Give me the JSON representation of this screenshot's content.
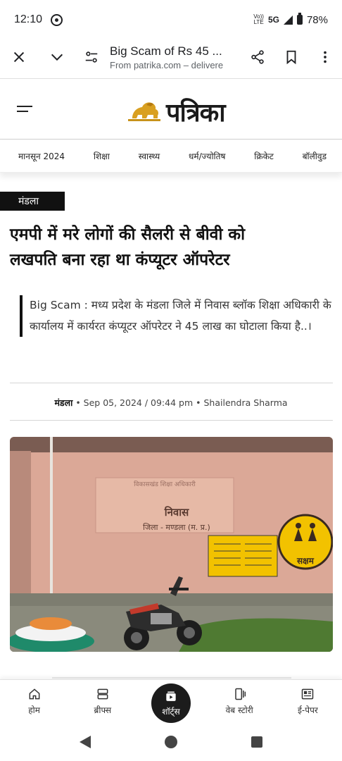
{
  "status_bar": {
    "time": "12:10",
    "network_top": "Vo)) ",
    "network_lte": "LTE",
    "network": "5G",
    "battery": "78%"
  },
  "custom_tab": {
    "title": "Big Scam of Rs 45 ...",
    "subtitle": "From patrika.com – delivere",
    "icons": [
      "close-icon",
      "chevron-down-icon",
      "page-settings-icon",
      "share-icon",
      "bookmark-icon",
      "more-vert-icon"
    ]
  },
  "site": {
    "logo_text": "पत्रिका"
  },
  "nav": {
    "items": [
      "मानसून 2024",
      "शिक्षा",
      "स्वास्थ्य",
      "धर्म/ज्योतिष",
      "क्रिकेट",
      "बॉलीवुड"
    ]
  },
  "article": {
    "category": "मंडला",
    "headline_line1": "एमपी में मरे लोगों की सैलरी से बीवी को",
    "headline_line2": "लखपति बना रहा था कंप्यूटर ऑपरेटर",
    "summary": "Big Scam : मध्य प्रदेश के मंडला जिले में निवास ब्लॉक शिक्षा अधिकारी के कार्यालय में कार्यरत कंप्यूटर ऑपरेटर ने 45 लाख का घोटाला किया है..।",
    "meta_location": "मंडला",
    "meta_date": "Sep 05, 2024 / 09:44 pm",
    "meta_author": "Shailendra Sharma",
    "meta_sep": "•"
  },
  "photo": {
    "sign_top": "विकासखंड शिक्षा अधिकारी",
    "sign_place": "निवास",
    "sign_district": "जिला - मण्डला (म. प्र.)",
    "badge_text": "सक्षम",
    "colors": {
      "wall": "#d9a392",
      "badge": "#f2c200"
    }
  },
  "bottom_nav": {
    "items": [
      {
        "label": "होम",
        "icon": "home-icon"
      },
      {
        "label": "ब्रीफ्स",
        "icon": "briefs-icon"
      },
      {
        "label": "शॉर्ट्स",
        "icon": "shorts-icon"
      },
      {
        "label": "वेब स्टोरी",
        "icon": "web-story-icon"
      },
      {
        "label": "ई-पेपर",
        "icon": "epaper-icon"
      }
    ]
  }
}
